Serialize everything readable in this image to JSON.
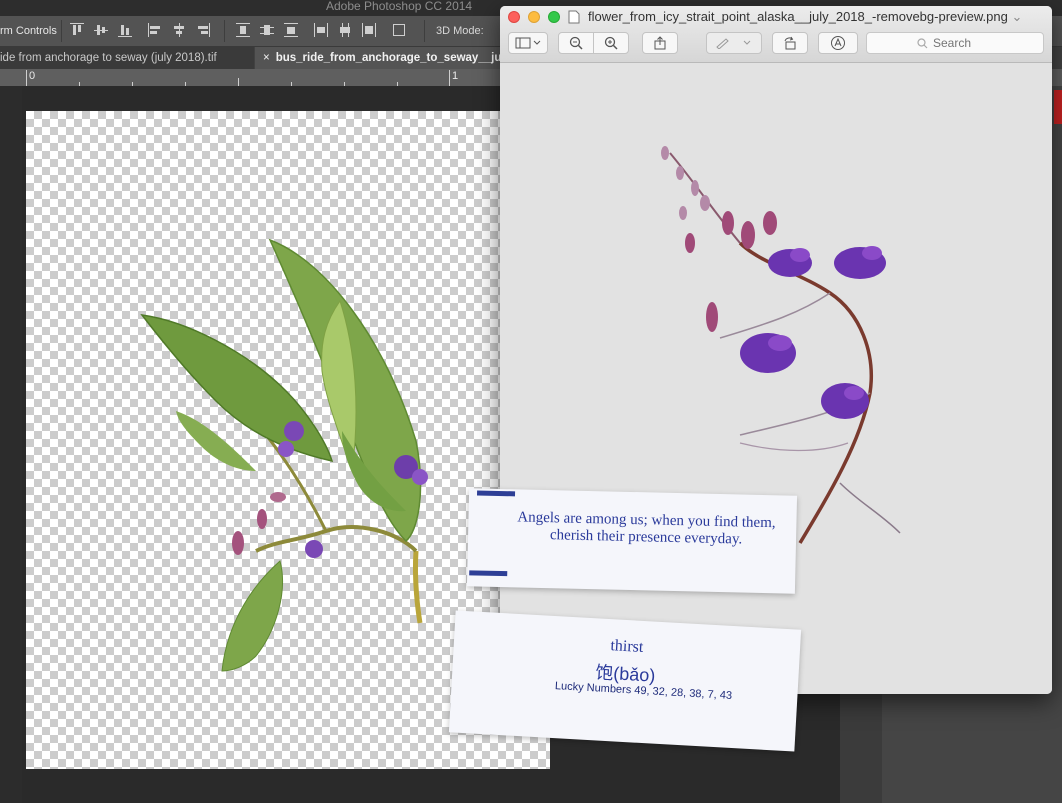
{
  "photoshop": {
    "app_title": "Adobe Photoshop CC 2014",
    "options_bar": {
      "transform_controls_label": "rm Controls",
      "mode_3d_label": "3D Mode:"
    },
    "tabs": [
      {
        "label": "ide from anchorage to seway (july 2018).tif",
        "close": ""
      },
      {
        "label": "bus_ride_from_anchorage_to_seway__ju",
        "close": "×"
      }
    ],
    "ruler": {
      "mark_0": "0",
      "mark_1": "1"
    }
  },
  "preview": {
    "title": "flower_from_icy_strait_point_alaska__july_2018_-removebg-preview.png",
    "title_chevron": "⌄",
    "search": {
      "placeholder": "Search"
    }
  },
  "fortune_1": {
    "text": "Angels are among us; when you find them, cherish their presence everyday."
  },
  "fortune_2": {
    "word": "thirst",
    "chinese": "饱(bǎo)",
    "lucky_numbers": "Lucky Numbers  49, 32, 28, 38, 7, 43"
  },
  "colors": {
    "accent_blue": "#2a3a9b",
    "close_red": "#fc605c",
    "minimize_yellow": "#fdbc40",
    "zoom_green": "#34c84a"
  }
}
